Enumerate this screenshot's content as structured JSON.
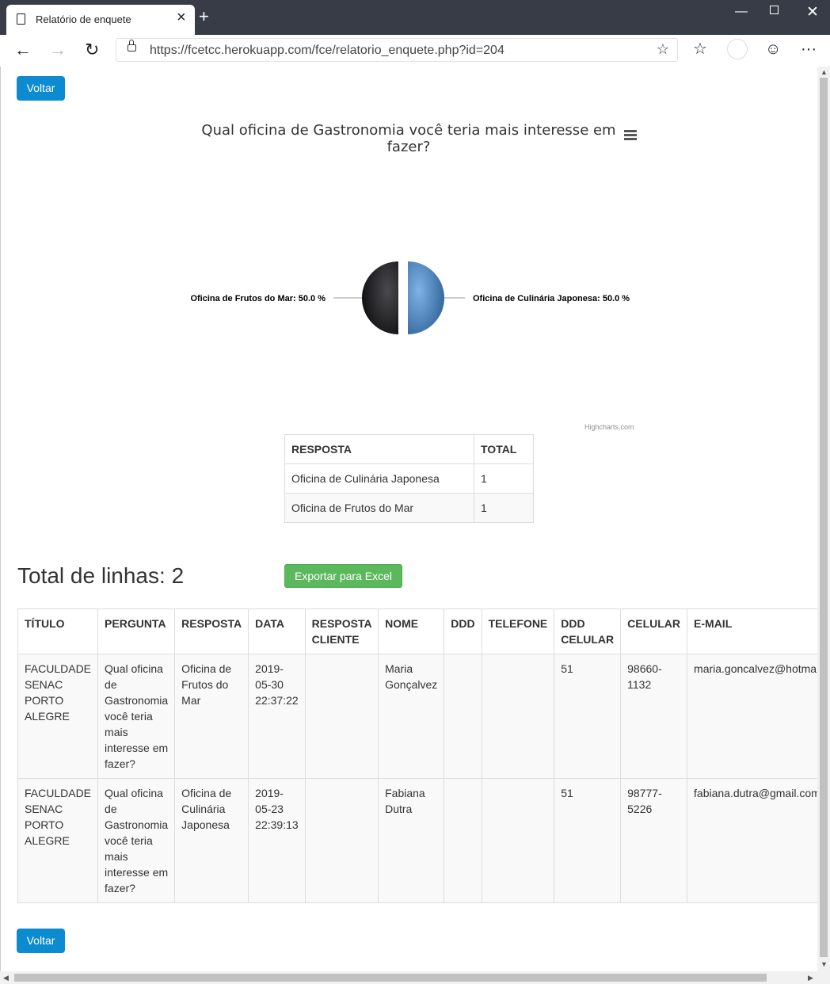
{
  "browser": {
    "tab_title": "Relatório de enquete",
    "url": "https://fcetcc.herokuapp.com/fce/relatorio_enquete.php?id=204"
  },
  "page": {
    "back_button_top": "Voltar",
    "back_button_bottom": "Voltar",
    "total_lines": "Total de linhas: 2",
    "export_button": "Exportar para Excel",
    "highcharts_credit": "Highcharts.com"
  },
  "chart_data": {
    "type": "pie",
    "title": "Qual oficina de Gastronomia você teria mais interesse em fazer?",
    "slices": [
      {
        "name": "Oficina de Culinária Japonesa",
        "value": 50.0,
        "label": "Oficina de Culinária Japonesa: 50.0 %",
        "color": "#4a88c7"
      },
      {
        "name": "Oficina de Frutos do Mar",
        "value": 50.0,
        "label": "Oficina de Frutos do Mar: 50.0 %",
        "color": "#1f1f22"
      }
    ]
  },
  "summary_table": {
    "headers": [
      "RESPOSTA",
      "TOTAL"
    ],
    "rows": [
      [
        "Oficina de Culinária Japonesa",
        "1"
      ],
      [
        "Oficina de Frutos do Mar",
        "1"
      ]
    ]
  },
  "detail_table": {
    "headers": [
      "TÍTULO",
      "PERGUNTA",
      "RESPOSTA",
      "DATA",
      "RESPOSTA CLIENTE",
      "NOME",
      "DDD",
      "TELEFONE",
      "DDD CELULAR",
      "CELULAR",
      "E-MAIL"
    ],
    "rows": [
      [
        "FACULDADE SENAC PORTO ALEGRE",
        "Qual oficina de Gastronomia você teria mais interesse em fazer?",
        "Oficina de Frutos do Mar",
        "2019-05-30 22:37:22",
        "",
        "Maria Gonçalvez",
        "",
        "",
        "51",
        "98660-1132",
        "maria.goncalvez@hotmail.com"
      ],
      [
        "FACULDADE SENAC PORTO ALEGRE",
        "Qual oficina de Gastronomia você teria mais interesse em fazer?",
        "Oficina de Culinária Japonesa",
        "2019-05-23 22:39:13",
        "",
        "Fabiana Dutra",
        "",
        "",
        "51",
        "98777-5226",
        "fabiana.dutra@gmail.com"
      ]
    ]
  }
}
